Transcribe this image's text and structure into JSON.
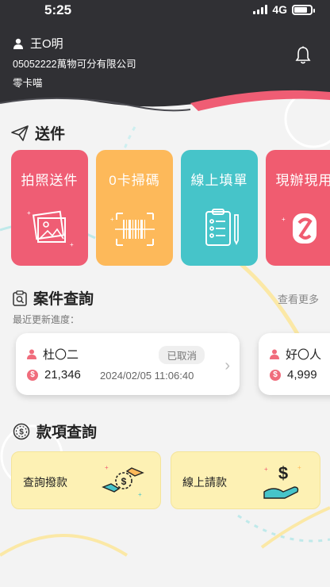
{
  "status_bar": {
    "time": "5:25",
    "network": "4G"
  },
  "user": {
    "name": "王O明",
    "company": "05052222萬物可分有限公司",
    "wallet": "零卡喵"
  },
  "send": {
    "title": "送件",
    "cards": [
      {
        "label": "拍照送件",
        "color": "#ef5d74",
        "icon": "photo-icon"
      },
      {
        "label": "0卡掃碼",
        "color": "#fdb95a",
        "icon": "barcode-scan-icon"
      },
      {
        "label": "線上填單",
        "color": "#46c4c9",
        "icon": "clipboard-form-icon"
      },
      {
        "label": "現辦現用",
        "color": "#f05c70",
        "icon": "instant-use-icon"
      }
    ]
  },
  "cases": {
    "title": "案件查詢",
    "see_more": "查看更多",
    "recent_label": "最近更新進度：",
    "items": [
      {
        "name": "杜〇二",
        "status": "已取消",
        "amount": "21,346",
        "time": "2024/02/05 11:06:40"
      },
      {
        "name": "好〇人",
        "amount": "4,999"
      }
    ]
  },
  "payments": {
    "title": "款項查詢",
    "cards": [
      {
        "label": "查詢撥款",
        "icon": "money-transfer-icon"
      },
      {
        "label": "線上請款",
        "icon": "money-request-icon"
      }
    ]
  },
  "colors": {
    "accent": "#ef5d74",
    "header": "#2f2f33",
    "pay_card": "#fdf1b4"
  }
}
